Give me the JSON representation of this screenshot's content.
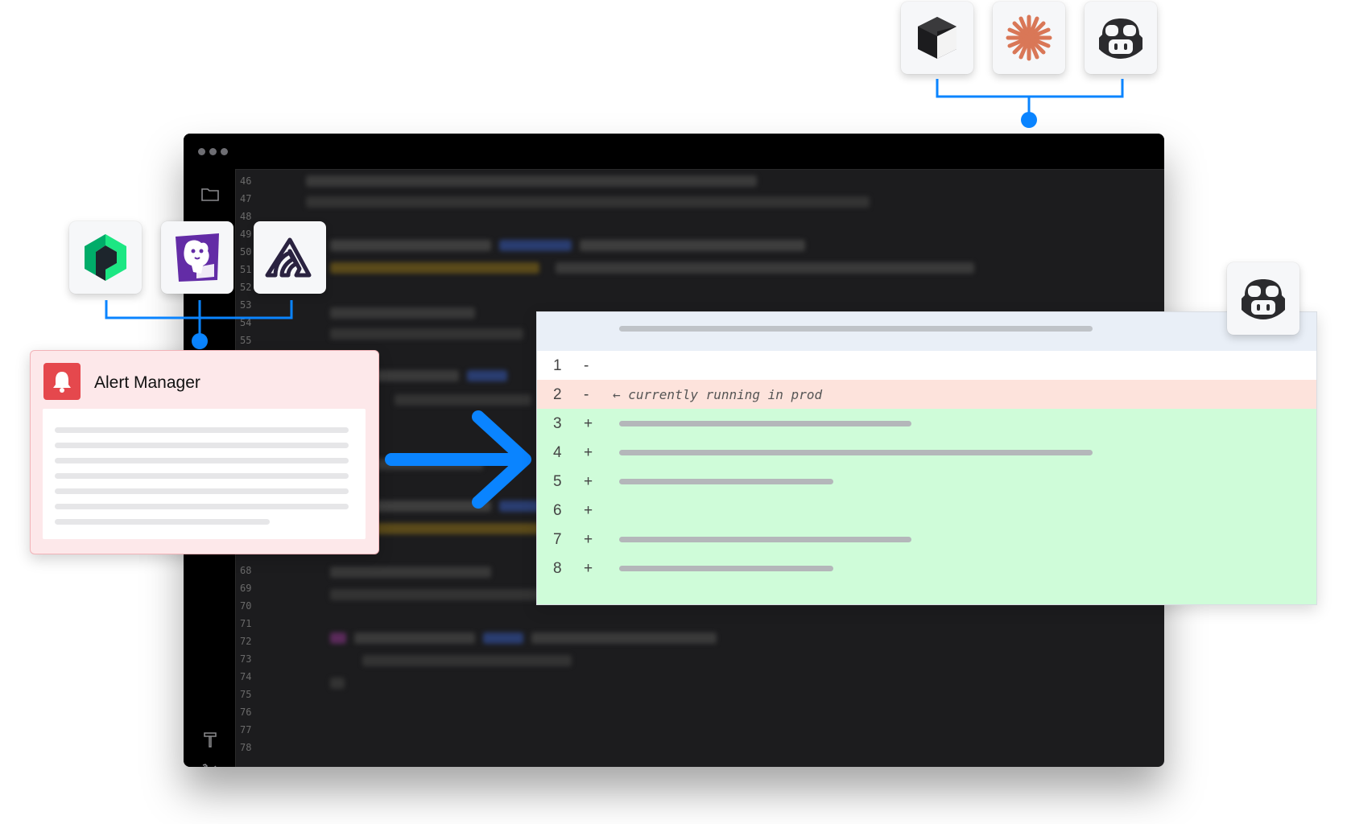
{
  "editor": {
    "line_numbers": [
      "46",
      "47",
      "48",
      "49",
      "50",
      "51",
      "52",
      "53",
      "54",
      "55",
      "68",
      "69",
      "70",
      "71",
      "72",
      "73",
      "74",
      "75",
      "76",
      "77",
      "78"
    ]
  },
  "alert_manager": {
    "title": "Alert Manager",
    "icon": "bell-icon"
  },
  "diff": {
    "rows": [
      {
        "num": "1",
        "sign": "-",
        "kind": "neutral",
        "text": ""
      },
      {
        "num": "2",
        "sign": "-",
        "kind": "removed",
        "text": "← currently running in prod"
      },
      {
        "num": "3",
        "sign": "+",
        "kind": "added",
        "text": ""
      },
      {
        "num": "4",
        "sign": "+",
        "kind": "added",
        "text": ""
      },
      {
        "num": "5",
        "sign": "+",
        "kind": "added",
        "text": ""
      },
      {
        "num": "6",
        "sign": "+",
        "kind": "added",
        "text": ""
      },
      {
        "num": "7",
        "sign": "+",
        "kind": "added",
        "text": ""
      },
      {
        "num": "8",
        "sign": "+",
        "kind": "added",
        "text": ""
      }
    ]
  },
  "integrations_top": [
    "cube-icon",
    "sparkle-asterisk-icon",
    "copilot-icon"
  ],
  "integrations_left": [
    "new-relic-icon",
    "datadog-icon",
    "sentry-icon"
  ],
  "agent_icon": "copilot-icon",
  "colors": {
    "accent_blue": "#0a84ff",
    "removed_bg": "#fde3dc",
    "added_bg": "#cffcd9",
    "alert_red": "#e5484d"
  }
}
